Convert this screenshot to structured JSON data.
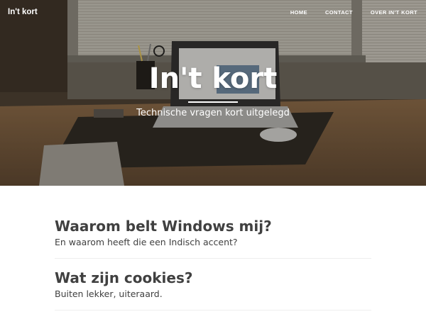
{
  "nav": {
    "brand": "In't kort",
    "links": [
      "HOME",
      "CONTACT",
      "OVER IN'T KORT"
    ]
  },
  "hero": {
    "title": "In't kort",
    "subtitle": "Technische vragen kort uitgelegd"
  },
  "posts": [
    {
      "title": "Waarom belt Windows mij?",
      "subtitle": "En waarom heeft die een Indisch accent?"
    },
    {
      "title": "Wat zijn cookies?",
      "subtitle": "Buiten lekker, uiteraard."
    }
  ]
}
